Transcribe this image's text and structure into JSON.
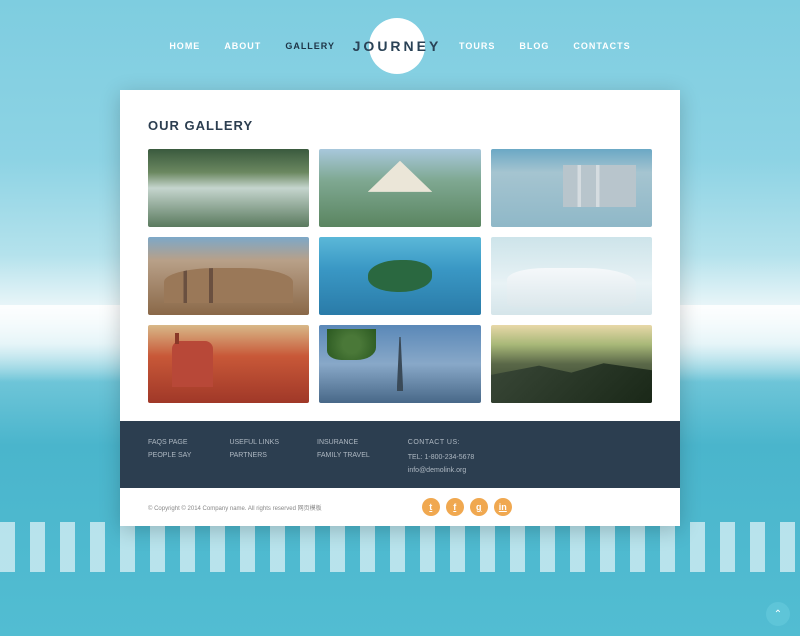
{
  "nav": {
    "items": [
      "HOME",
      "ABOUT",
      "GALLERY",
      "TOURS",
      "BLOG",
      "CONTACTS"
    ],
    "active": "GALLERY",
    "logo": "JOURNEY"
  },
  "page": {
    "title": "OUR GALLERY"
  },
  "gallery": {
    "items": [
      {
        "name": "waterfall"
      },
      {
        "name": "thai-temple"
      },
      {
        "name": "resort-hotel"
      },
      {
        "name": "colosseum"
      },
      {
        "name": "tropical-island"
      },
      {
        "name": "arctic-birds"
      },
      {
        "name": "red-bridge"
      },
      {
        "name": "eiffel-tower"
      },
      {
        "name": "mountain-sunset"
      }
    ]
  },
  "footer": {
    "col1": [
      "FAQS PAGE",
      "PEOPLE SAY"
    ],
    "col2": [
      "USEFUL LINKS",
      "PARTNERS"
    ],
    "col3": [
      "INSURANCE",
      "FAMILY TRAVEL"
    ],
    "contact": {
      "title": "CONTACT US:",
      "tel": "TEL: 1-800-234-5678",
      "email": "info@demolink.org"
    }
  },
  "subfooter": {
    "copyright": "© Copyright © 2014 Company name. All rights reserved 网页模板",
    "socials": [
      "twitter",
      "facebook",
      "google-plus",
      "linkedin"
    ],
    "glyphs": {
      "twitter": "t",
      "facebook": "f",
      "google-plus": "g",
      "linkedin": "in"
    }
  }
}
